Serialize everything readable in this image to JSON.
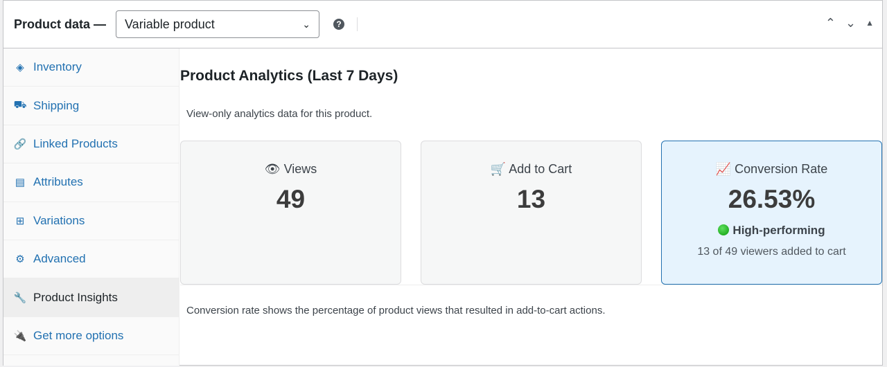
{
  "header": {
    "title": "Product data —",
    "product_type": "Variable product",
    "help": "?"
  },
  "sidebar": {
    "items": [
      {
        "label": "Inventory",
        "icon": "tag-icon"
      },
      {
        "label": "Shipping",
        "icon": "truck-icon"
      },
      {
        "label": "Linked Products",
        "icon": "link-icon"
      },
      {
        "label": "Attributes",
        "icon": "list-icon"
      },
      {
        "label": "Variations",
        "icon": "grid-icon"
      },
      {
        "label": "Advanced",
        "icon": "gear-icon"
      },
      {
        "label": "Product Insights",
        "icon": "wrench-icon",
        "active": true
      },
      {
        "label": "Get more options",
        "icon": "plug-icon"
      }
    ]
  },
  "main": {
    "title": "Product Analytics (Last 7 Days)",
    "description": "View-only analytics data for this product.",
    "cards": [
      {
        "label": "Views",
        "value": "49"
      },
      {
        "label": "Add to Cart",
        "value": "13"
      },
      {
        "label": "Conversion Rate",
        "value": "26.53%",
        "badge": "High-performing",
        "detail": "13 of 49 viewers added to cart"
      }
    ],
    "note": "Conversion rate shows the percentage of product views that resulted in add-to-cart actions."
  },
  "colors": {
    "accent": "#2271b1",
    "highlight_bg": "#e6f3fd",
    "good": "#0a9a0a"
  }
}
